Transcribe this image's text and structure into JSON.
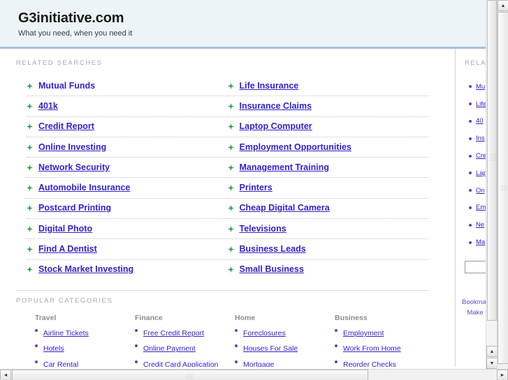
{
  "header": {
    "title": "G3initiative.com",
    "tagline": "What you need, when you need it"
  },
  "main": {
    "related_searches_label": "RELATED SEARCHES",
    "popular_categories_label": "POPULAR CATEGORIES",
    "links_left": [
      "Mutual Funds",
      "401k",
      "Credit Report",
      "Online Investing",
      "Network Security",
      "Automobile Insurance",
      "Postcard Printing",
      "Digital Photo",
      "Find A Dentist",
      "Stock Market Investing"
    ],
    "links_right": [
      "Life Insurance",
      "Insurance Claims",
      "Laptop Computer",
      "Employment Opportunities",
      "Management Training",
      "Printers",
      "Cheap Digital Camera",
      "Televisions",
      "Business Leads",
      "Small Business"
    ],
    "categories": [
      {
        "title": "Travel",
        "items": [
          "Airline Tickets",
          "Hotels",
          "Car Rental"
        ]
      },
      {
        "title": "Finance",
        "items": [
          "Free Credit Report",
          "Online Payment",
          "Credit Card Application"
        ]
      },
      {
        "title": "Home",
        "items": [
          "Foreclosures",
          "Houses For Sale",
          "Mortgage"
        ]
      },
      {
        "title": "Business",
        "items": [
          "Employment",
          "Work From Home",
          "Reorder Checks"
        ]
      }
    ]
  },
  "sidebar": {
    "related_label": "RELATED",
    "items": [
      "Mu",
      "Life",
      "40",
      "Ins",
      "Cre",
      "Lap",
      "On",
      "Em",
      "Ne",
      "Ma"
    ],
    "search_value": "",
    "footer_line1": "Bookmark",
    "footer_line2": "Make this"
  },
  "scrollbars": {
    "up_arrow": "▲",
    "down_arrow": "▼",
    "left_arrow": "◄",
    "right_arrow": "►"
  },
  "colors": {
    "link": "#3322cc",
    "header_bg": "#edf4f8",
    "header_rule": "#a8c0e0",
    "bullet_green": "#2aa34a",
    "bullet_purple": "#5b3fd0",
    "label_gray": "#a8a8a8"
  }
}
